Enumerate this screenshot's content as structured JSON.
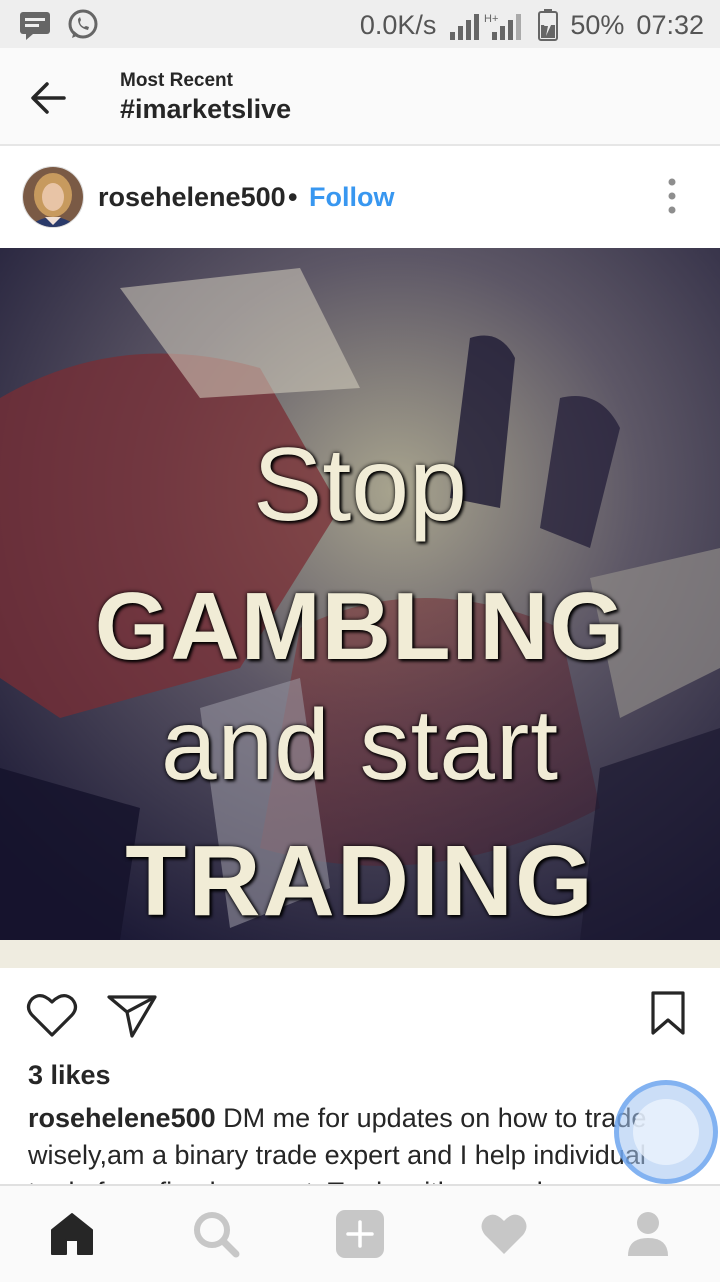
{
  "status_bar": {
    "net_speed": "0.0K/s",
    "network_type": "H+",
    "battery": "50%",
    "time": "07:32",
    "left_icons": [
      "message-icon",
      "whatsapp-icon"
    ]
  },
  "header": {
    "subtitle": "Most Recent",
    "title": "#imarketslive"
  },
  "post": {
    "username": "rosehelene500",
    "separator": "•",
    "follow_label": "Follow",
    "image_text": {
      "line1": "Stop",
      "line2": "GAMBLING",
      "line3": "and start",
      "line4": "TRADING"
    },
    "likes": "3 likes",
    "caption_username": "rosehelene500",
    "caption_text": "DM me for updates on how to trade wisely,am a binary trade expert and I help individual trade for a fixed amount. Trade with a good"
  },
  "bottom_nav": {
    "items": [
      "home-icon",
      "search-icon",
      "add-icon",
      "activity-heart-icon",
      "profile-icon"
    ]
  },
  "colors": {
    "accent": "#3897f0",
    "text": "#262626",
    "nav_inactive": "#c7c7c7"
  }
}
